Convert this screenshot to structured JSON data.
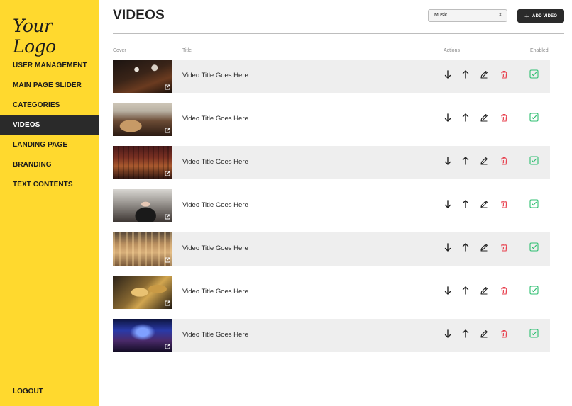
{
  "logo": "Your Logo",
  "sidebar": {
    "items": [
      {
        "label": "USER MANAGEMENT"
      },
      {
        "label": "MAIN PAGE SLIDER"
      },
      {
        "label": "CATEGORIES"
      },
      {
        "label": "VIDEOS",
        "active": true
      },
      {
        "label": "LANDING PAGE"
      },
      {
        "label": "BRANDING"
      },
      {
        "label": "TEXT CONTENTS"
      }
    ],
    "logout": "LOGOUT"
  },
  "header": {
    "title": "VIDEOS",
    "category_select": "Music",
    "add_button": "ADD VIDEO"
  },
  "table": {
    "columns": {
      "cover": "Cover",
      "title": "Title",
      "actions": "Actions",
      "enabled": "Enabled"
    },
    "rows": [
      {
        "title": "Video Title Goes Here",
        "enabled": true,
        "cover_icon": "external-link-icon"
      },
      {
        "title": "Video Title Goes Here",
        "enabled": true,
        "cover_icon": "external-link-icon"
      },
      {
        "title": "Video Title Goes Here",
        "enabled": true,
        "cover_icon": "external-link-icon"
      },
      {
        "title": "Video Title Goes Here",
        "enabled": true,
        "cover_icon": "external-link-icon"
      },
      {
        "title": "Video Title Goes Here",
        "enabled": true,
        "cover_icon": "external-link-icon"
      },
      {
        "title": "Video Title Goes Here",
        "enabled": true,
        "cover_icon": "external-link-icon"
      },
      {
        "title": "Video Title Goes Here",
        "enabled": true,
        "cover_icon": "external-link-icon"
      }
    ],
    "action_icons": [
      "arrow-down-icon",
      "arrow-up-icon",
      "pencil-icon",
      "trash-icon"
    ]
  },
  "colors": {
    "sidebar_bg": "#ffd92e",
    "active_nav_bg": "#2a2a2a",
    "row_shade": "#eeeeee",
    "delete_red": "#e8414f",
    "enabled_green": "#2fbf71"
  }
}
